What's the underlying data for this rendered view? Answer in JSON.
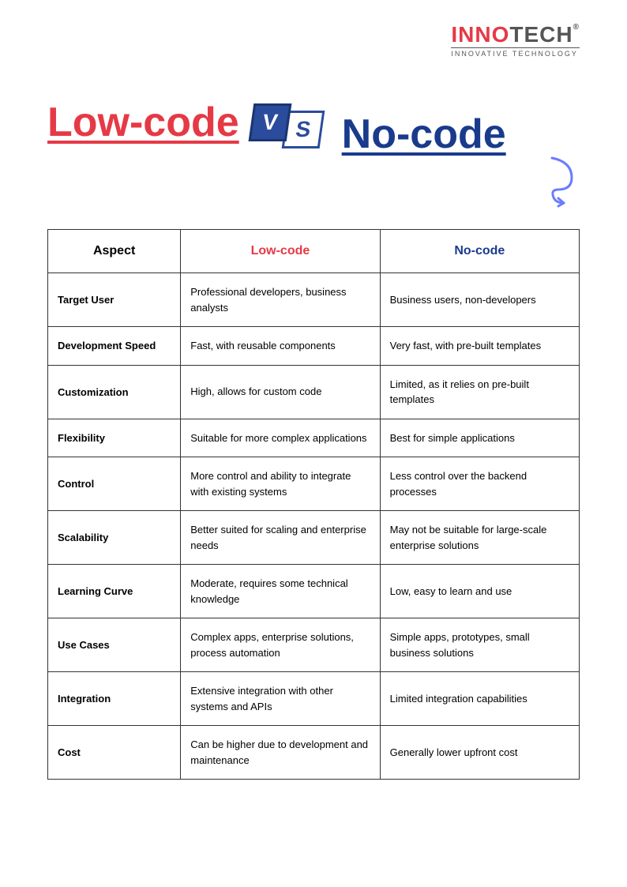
{
  "logo": {
    "part1": "INNO",
    "part2": "TECH",
    "registered": "®",
    "subtitle": "INNOVATIVE TECHNOLOGY"
  },
  "title": {
    "lowcode": "Low-code",
    "nocode": "No-code",
    "vs_v": "V",
    "vs_s": "S"
  },
  "colors": {
    "lowcode": "#e63946",
    "nocode": "#1a3b8c",
    "arrow": "#6b7cff"
  },
  "table": {
    "headers": {
      "aspect": "Aspect",
      "lowcode": "Low-code",
      "nocode": "No-code"
    },
    "rows": [
      {
        "aspect": "Target User",
        "lowcode": "Professional developers, business analysts",
        "nocode": "Business users, non-developers"
      },
      {
        "aspect": "Development Speed",
        "lowcode": "Fast, with reusable components",
        "nocode": "Very fast, with pre-built templates"
      },
      {
        "aspect": "Customization",
        "lowcode": "High, allows for custom code",
        "nocode": "Limited, as it relies on pre-built templates"
      },
      {
        "aspect": "Flexibility",
        "lowcode": "Suitable for more complex applications",
        "nocode": "Best for simple applications"
      },
      {
        "aspect": "Control",
        "lowcode": "More control and ability to integrate with existing systems",
        "nocode": "Less control over the backend processes"
      },
      {
        "aspect": "Scalability",
        "lowcode": "Better suited for scaling and enterprise needs",
        "nocode": "May not be suitable for large-scale enterprise solutions"
      },
      {
        "aspect": "Learning Curve",
        "lowcode": "Moderate, requires some technical knowledge",
        "nocode": "Low, easy to learn and use"
      },
      {
        "aspect": "Use Cases",
        "lowcode": "Complex apps, enterprise solutions, process automation",
        "nocode": "Simple apps, prototypes, small business solutions"
      },
      {
        "aspect": "Integration",
        "lowcode": "Extensive integration with other systems and APIs",
        "nocode": "Limited integration capabilities"
      },
      {
        "aspect": "Cost",
        "lowcode": "Can be higher due to development and maintenance",
        "nocode": "Generally lower upfront cost"
      }
    ]
  }
}
